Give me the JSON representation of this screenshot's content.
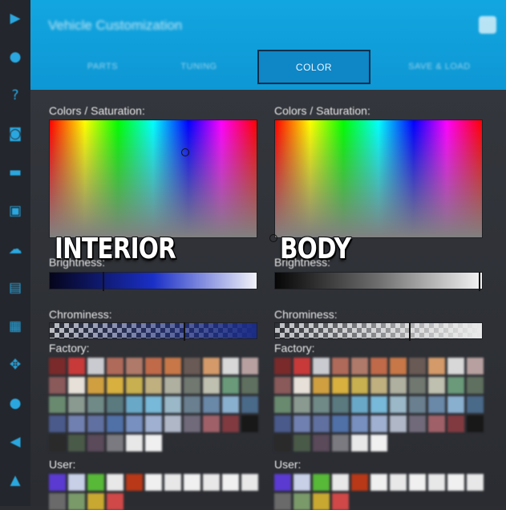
{
  "header": {
    "title": "Vehicle Customization",
    "tabs": [
      "PARTS",
      "TUNING",
      "COLOR",
      "SAVE & LOAD"
    ],
    "active_tab": "COLOR"
  },
  "rail_icons": [
    "▶",
    "●",
    "?",
    "◙",
    "▬",
    "▣",
    "☁",
    "▤",
    "▦",
    "✥",
    "●",
    "◀",
    "▲"
  ],
  "panels": [
    {
      "id": "interior",
      "colors_label": "Colors / Saturation:",
      "overlay_label": "INTERIOR",
      "picker": {
        "hue_percent": 65,
        "saturation_percent": 73
      },
      "brightness_label": "Brightness:",
      "brightness_value": 0.26,
      "brightness_gradient": [
        "#05051a",
        "#1a2fc7",
        "#f2f2f8"
      ],
      "chromeness_label": "Chrominess:",
      "chromeness_value": 0.65,
      "chromeness_color": "#1b2c86",
      "factory_label": "Factory:",
      "user_label": "User:"
    },
    {
      "id": "body",
      "colors_label": "Colors / Saturation:",
      "overlay_label": "BODY",
      "picker": {
        "hue_percent": 0,
        "saturation_percent": 100
      },
      "brightness_label": "Brightness:",
      "brightness_value": 0.99,
      "brightness_gradient": [
        "#060606",
        "#6e6e6e",
        "#f4f4f4"
      ],
      "chromeness_label": "Chrominess:",
      "chromeness_value": 0.65,
      "chromeness_color": "#eaeaea",
      "factory_label": "Factory:",
      "user_label": "User:"
    }
  ],
  "factory_colors": [
    "#7a2a2a",
    "#c83a3a",
    "#c9cbd0",
    "#b06a5a",
    "#b07a6a",
    "#c06a4a",
    "#c87848",
    "#6a5a55",
    "#d49a6a",
    "#d8d8d8",
    "#b8a0a0",
    "#8a5a5a",
    "#e6e0d8",
    "#d0a040",
    "#d8b040",
    "#c8b050",
    "#c0b080",
    "#b0b0a0",
    "#707870",
    "#c0c0b0",
    "#6a9a7a",
    "#607060",
    "#6a8a70",
    "#8a9a90",
    "#708a88",
    "#5a7a80",
    "#6aa8c8",
    "#78b8d8",
    "#9ab8c8",
    "#6a8090",
    "#6a88a8",
    "#8ab0d0",
    "#4a6a8a",
    "#4a5a8a",
    "#7080b0",
    "#6070a0",
    "#5070a8",
    "#7890c0",
    "#a0b0d0",
    "#b0b8c8",
    "#706a7a",
    "#a06068",
    "#803a40",
    "#181818",
    "#2a2a2a",
    "#4a5a48",
    "#5a4a5a",
    "#7a7a80",
    "#e8e8e8",
    "#f0f0f0"
  ],
  "user_colors": [
    "#5a3ad0",
    "#c8d0e8",
    "#58b838",
    "#e8e8e8",
    "#b83818",
    "#f0f0f0",
    "#e8e8e8",
    "#f0f0f0",
    "#e8e8e8",
    "#f0f0f0",
    "#e8e8e8",
    "#6a6a6a",
    "#7a9a6a",
    "#c8a830",
    "#d04848"
  ]
}
